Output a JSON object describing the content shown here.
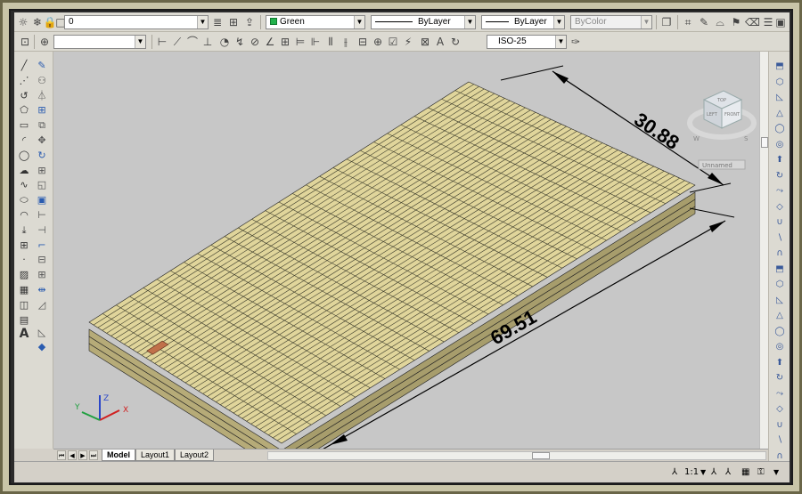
{
  "toolbar1": {
    "layer_name": "0",
    "color_value": "Green",
    "linetype_value": "ByLayer",
    "lineweight_value": "ByLayer",
    "plotstyle_value": "ByColor"
  },
  "toolbar2": {
    "dimstyle_value": "ISO-25"
  },
  "viewcube": {
    "top_label": "TOP",
    "left_label": "LEFT",
    "front_label": "FRONT",
    "compass_w": "W",
    "compass_s": "S",
    "ucs_label": "Unnamed"
  },
  "drawing": {
    "dim_width": "30.88",
    "dim_length": "69.51",
    "tile_color": "#e0d59b",
    "highlight_color": "#c0704a"
  },
  "tabs": {
    "model": "Model",
    "layout1": "Layout1",
    "layout2": "Layout2"
  },
  "statusbar": {
    "annotation_scale": "1:1"
  },
  "icons": {
    "left_column": [
      "line-icon",
      "construction-line-icon",
      "polyline-icon",
      "polygon-icon",
      "rectangle-icon",
      "arc-icon",
      "circle-icon",
      "revision-cloud-icon",
      "spline-icon",
      "ellipse-icon",
      "ellipse-arc-icon",
      "insert-block-icon",
      "make-block-icon",
      "point-icon",
      "hatch-icon",
      "gradient-icon",
      "region-icon",
      "table-icon",
      "multiline-text-icon"
    ],
    "right_column": [
      "box-icon",
      "cylinder-icon",
      "wedge-icon",
      "cone-icon",
      "sphere-icon",
      "torus-icon",
      "extrude-icon",
      "revolve-icon",
      "sweep-icon",
      "loft-icon",
      "union-icon",
      "subtract-icon",
      "intersect-icon"
    ]
  }
}
